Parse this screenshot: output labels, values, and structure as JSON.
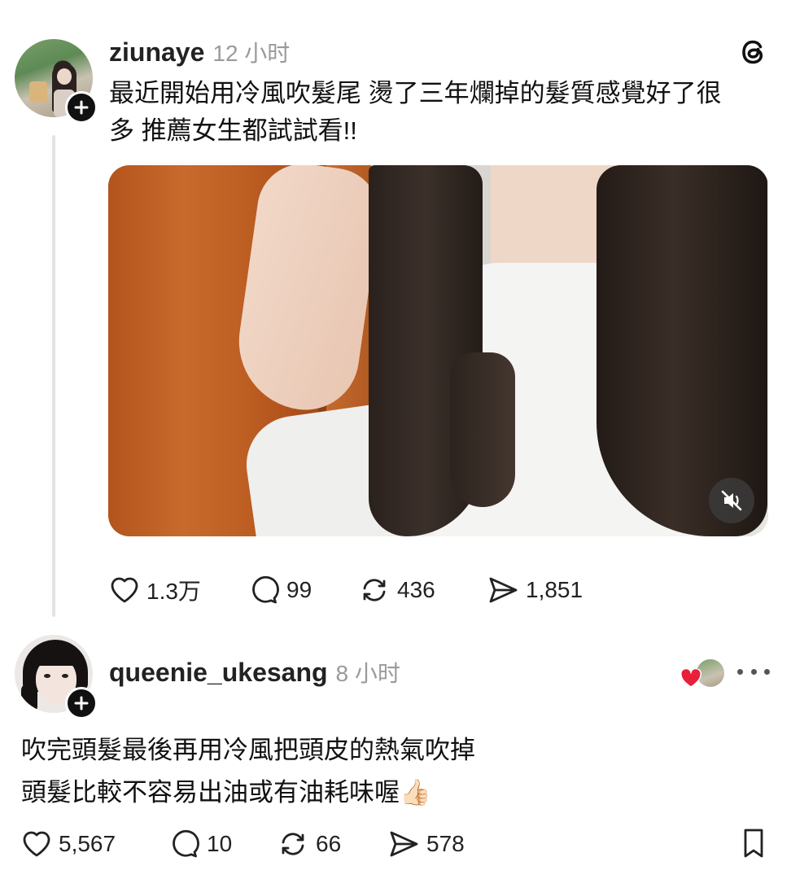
{
  "post": {
    "username": "ziunaye",
    "time": "12 小时",
    "text_line1": "最近開始用冷風吹髮尾 燙了三年爛掉的髮質感覺好了很",
    "text_line2": "多 推薦女生都試試看!!",
    "media": {
      "type": "video",
      "muted": true
    },
    "actions": {
      "likes": "1.3万",
      "comments": "99",
      "reposts": "436",
      "shares": "1,851"
    }
  },
  "reply": {
    "username": "queenie_ukesang",
    "time": "8 小时",
    "text_line1": "吹完頭髮最後再用冷風把頭皮的熱氣吹掉",
    "text_line2": "頭髮比較不容易出油或有油耗味喔",
    "emoji": "👍🏻",
    "actions": {
      "likes": "5,567",
      "comments": "10",
      "reposts": "66",
      "shares": "578"
    }
  },
  "icons": {
    "app_logo": "threads-logo-icon",
    "like": "heart-icon",
    "comment": "comment-bubble-icon",
    "repost": "repost-icon",
    "share": "send-icon",
    "more": "more-options-icon",
    "save": "bookmark-icon",
    "mute": "speaker-muted-icon"
  },
  "colors": {
    "liked_heart": "#e8203a",
    "secondary_text": "#9a9a9a"
  }
}
